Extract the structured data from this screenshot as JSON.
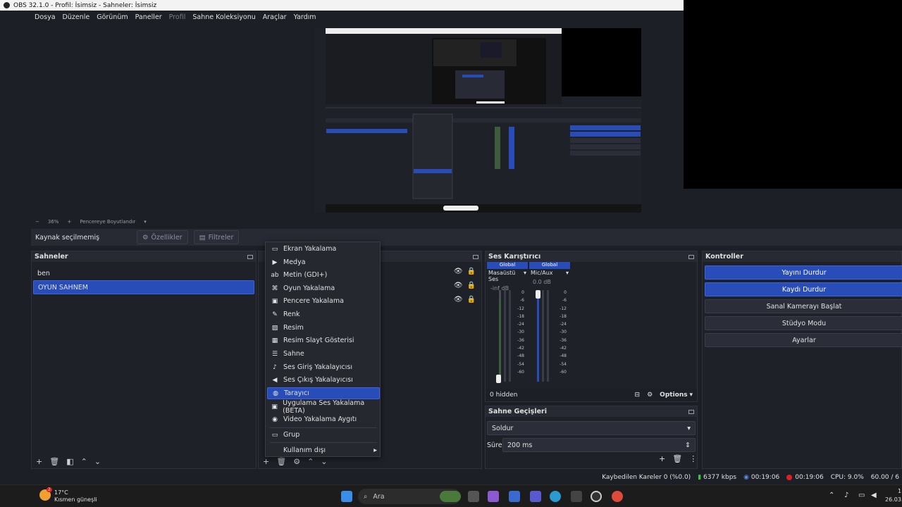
{
  "window": {
    "title": "OBS 32.1.0 - Profil: İsimsiz - Sahneler: İsimsiz"
  },
  "menu": [
    "Dosya",
    "Düzenle",
    "Görünüm",
    "Paneller",
    "Profil",
    "Sahne Koleksiyonu",
    "Araçlar",
    "Yardım"
  ],
  "zoom": {
    "minus": "−",
    "value": "36%",
    "plus": "+",
    "mode": "Pencereye Boyutlandır"
  },
  "source_toolbar": {
    "status": "Kaynak seçilmemiş",
    "properties": "Özellikler",
    "filters": "Filtreler"
  },
  "scenes": {
    "title": "Sahneler",
    "items": [
      "ben",
      "OYUN SAHNEM"
    ],
    "selected_index": 1
  },
  "context_menu": {
    "items": [
      "Ekran Yakalama",
      "Medya",
      "Metin (GDI+)",
      "Oyun Yakalama",
      "Pencere Yakalama",
      "Renk",
      "Resim",
      "Resim Slayt Gösterisi",
      "Sahne",
      "Ses Giriş Yakalayıcısı",
      "Ses Çıkış Yakalayıcısı",
      "Tarayıcı",
      "Uygulama Ses Yakalama (BETA)",
      "Video Yakalama Aygıtı",
      "Grup",
      "Kullanım dışı"
    ],
    "highlighted": "Tarayıcı"
  },
  "mixer": {
    "title": "Ses Karıştırıcı",
    "channels": [
      {
        "tag": "Global",
        "name": "Masaüstü Ses",
        "db": "-inf dB",
        "level": 0.0
      },
      {
        "tag": "Global",
        "name": "Mic/Aux",
        "db": "0.0 dB",
        "level": 1.0
      }
    ],
    "scale": [
      "0",
      "-6",
      "-12",
      "-18",
      "-24",
      "-30",
      "-36",
      "-42",
      "-48",
      "-54",
      "-60"
    ],
    "hidden": "0 hidden",
    "options": "Options"
  },
  "transitions": {
    "title": "Sahne Geçişleri",
    "selected": "Soldur",
    "duration_label": "Süre",
    "duration_value": "200 ms"
  },
  "controls": {
    "title": "Kontroller",
    "buttons": [
      "Yayını Durdur",
      "Kaydı Durdur",
      "Sanal Kamerayı Başlat",
      "Stüdyo Modu",
      "Ayarlar"
    ]
  },
  "status": {
    "dropped": "Kaybedilen Kareler 0 (%0.0)",
    "bitrate": "6377 kbps",
    "stream_time": "00:19:06",
    "rec_time": "00:19:06",
    "cpu": "CPU: 9.0%",
    "fps": "60.00 / 6"
  },
  "taskbar": {
    "weather_temp": "17°C",
    "weather_text": "Kısmen güneşli",
    "weather_badge": "2",
    "search": "Ara",
    "date": "26.03.",
    "time": "1"
  },
  "colors": {
    "accent": "#284cb8",
    "bg": "#1d1f26",
    "dock": "#1f2129",
    "rec": "#e02020",
    "green": "#40c040"
  }
}
